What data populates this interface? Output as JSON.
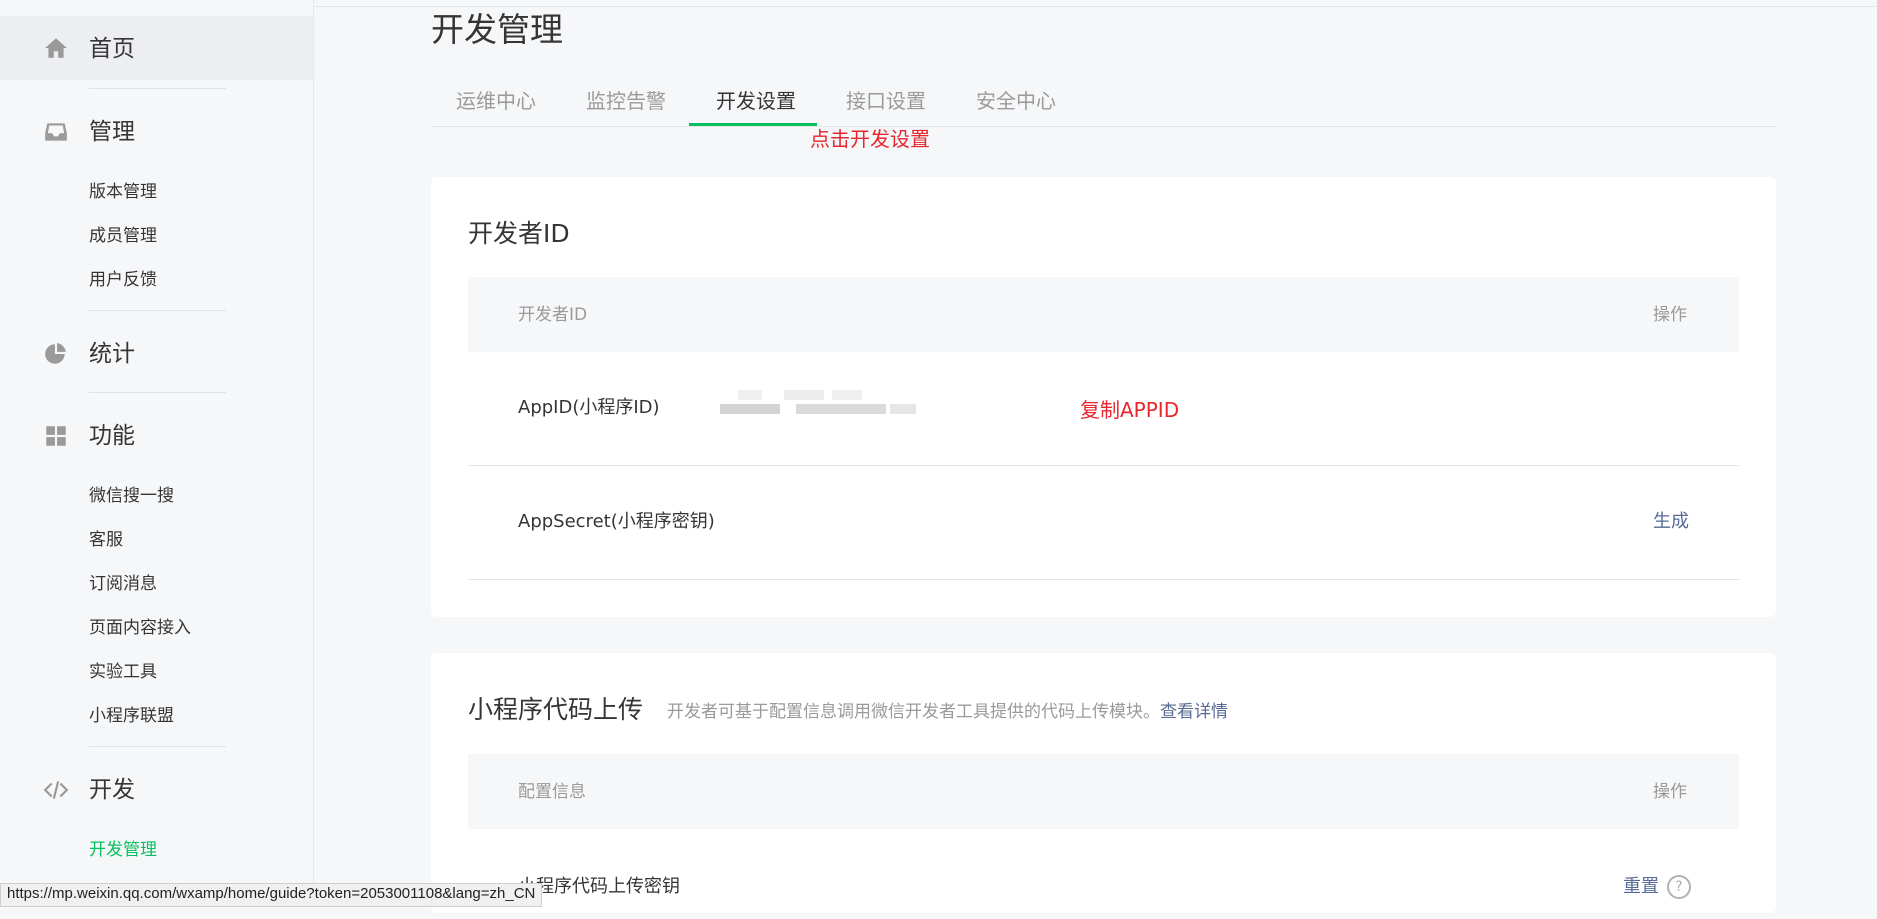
{
  "sidebar": {
    "home": "首页",
    "manage": {
      "title": "管理",
      "items": [
        "版本管理",
        "成员管理",
        "用户反馈"
      ]
    },
    "stats": {
      "title": "统计"
    },
    "features": {
      "title": "功能",
      "items": [
        "微信搜一搜",
        "客服",
        "订阅消息",
        "页面内容接入",
        "实验工具",
        "小程序联盟"
      ]
    },
    "dev": {
      "title": "开发",
      "items": [
        "开发管理"
      ]
    }
  },
  "page": {
    "title": "开发管理",
    "tabs": [
      "运维中心",
      "监控告警",
      "开发设置",
      "接口设置",
      "安全中心"
    ],
    "active_tab_index": 2,
    "tab_annotation": "点击开发设置"
  },
  "developer_id": {
    "title": "开发者ID",
    "header": {
      "col1": "开发者ID",
      "col2": "操作"
    },
    "rows": [
      {
        "label": "AppID(小程序ID)",
        "annotation": "复制APPID",
        "action": ""
      },
      {
        "label": "AppSecret(小程序密钥)",
        "action": "生成"
      }
    ]
  },
  "code_upload": {
    "title": "小程序代码上传",
    "desc": "开发者可基于配置信息调用微信开发者工具提供的代码上传模块。",
    "desc_link": "查看详情",
    "header": {
      "col1": "配置信息",
      "col2": "操作"
    },
    "rows": [
      {
        "label": "小程序代码上传密钥",
        "action": "重置"
      }
    ]
  },
  "status_url": "https://mp.weixin.qq.com/wxamp/home/guide?token=2053001108&lang=zh_CN",
  "colors": {
    "accent": "#07c160",
    "link": "#576b95",
    "annotation": "#e8262d"
  }
}
